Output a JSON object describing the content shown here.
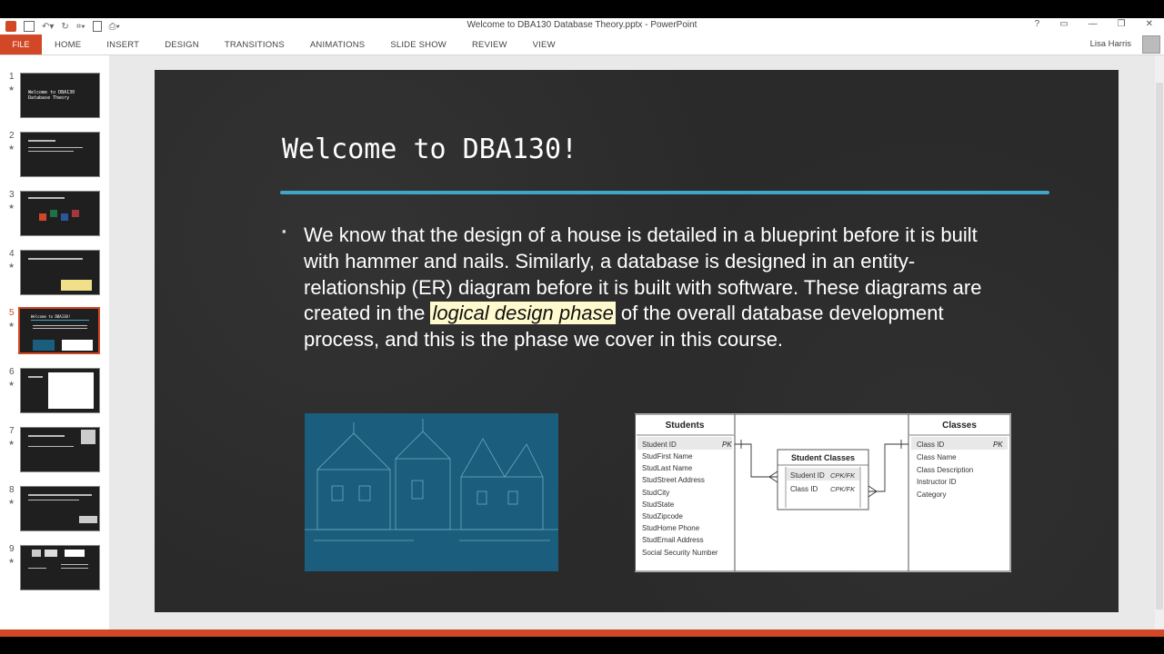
{
  "window": {
    "title": "Welcome to DBA130 Database Theory.pptx - PowerPoint"
  },
  "ribbon": {
    "file_label": "FILE",
    "tabs": [
      "HOME",
      "INSERT",
      "DESIGN",
      "TRANSITIONS",
      "ANIMATIONS",
      "SLIDE SHOW",
      "REVIEW",
      "VIEW"
    ],
    "user": "Lisa Harris"
  },
  "thumbnails": [
    {
      "num": "1",
      "text": "Welcome to DBA130 Database Theory"
    },
    {
      "num": "2",
      "text": ""
    },
    {
      "num": "3",
      "text": ""
    },
    {
      "num": "4",
      "text": ""
    },
    {
      "num": "5",
      "text": "Welcome to DBA130!"
    },
    {
      "num": "6",
      "text": ""
    },
    {
      "num": "7",
      "text": ""
    },
    {
      "num": "8",
      "text": ""
    },
    {
      "num": "9",
      "text": ""
    }
  ],
  "slide": {
    "title": "Welcome to DBA130!",
    "body_before": "We know that the design of a house is detailed in a blueprint before it is built with hammer and nails.  Similarly, a database is designed in an entity-relationship (ER) diagram before it is built with software.  These diagrams are created in the ",
    "highlight": "logical design phase",
    "body_after": " of the overall database development process, and this is the phase we cover in this course."
  },
  "er": {
    "students": {
      "title": "Students",
      "pk_label": "PK",
      "fields": [
        "Student ID",
        "StudFirst Name",
        "StudLast Name",
        "StudStreet Address",
        "StudCity",
        "StudState",
        "StudZipcode",
        "StudHome Phone",
        "StudEmail Address",
        "Social Security Number"
      ]
    },
    "student_classes": {
      "title": "Student Classes",
      "fields": [
        "Student ID",
        "Class ID"
      ],
      "keys": [
        "CPK/FK",
        "CPK/FK"
      ]
    },
    "classes": {
      "title": "Classes",
      "pk_label": "PK",
      "fields": [
        "Class ID",
        "Class Name",
        "Class Description",
        "Instructor ID",
        "Category"
      ]
    }
  }
}
